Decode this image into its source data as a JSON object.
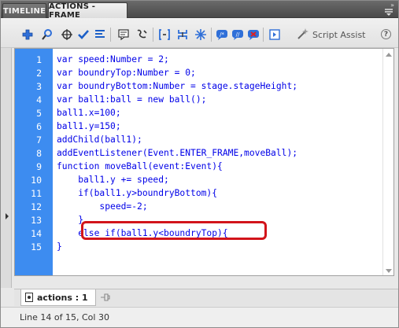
{
  "tabs": {
    "timeline": "TIMELINE",
    "actions": "ACTIONS - FRAME"
  },
  "toolbar": {
    "icons": [
      "add-statement-icon",
      "find-icon",
      "insert-target-path-icon",
      "check-syntax-icon",
      "auto-format-icon",
      "show-code-hint-icon",
      "debug-options-icon",
      "collapse-between-braces-icon",
      "collapse-selection-icon",
      "expand-all-icon",
      "apply-block-comment-icon",
      "apply-line-comment-icon",
      "remove-comment-icon",
      "show-hide-toolbox-icon",
      "script-assist-icon",
      "help-icon"
    ],
    "script_assist_label": "Script Assist",
    "help_label": "?"
  },
  "editor": {
    "lines": [
      {
        "n": "1",
        "code": "var speed:Number = 2;"
      },
      {
        "n": "2",
        "code": "var boundryTop:Number = 0;"
      },
      {
        "n": "3",
        "code": "var boundryBottom:Number = stage.stageHeight;"
      },
      {
        "n": "4",
        "code": "var ball1:ball = new ball();"
      },
      {
        "n": "5",
        "code": "ball1.x=100;"
      },
      {
        "n": "6",
        "code": "ball1.y=150;"
      },
      {
        "n": "7",
        "code": "addChild(ball1);"
      },
      {
        "n": "8",
        "code": "addEventListener(Event.ENTER_FRAME,moveBall);"
      },
      {
        "n": "9",
        "code": "function moveBall(event:Event){"
      },
      {
        "n": "10",
        "code": "    ball1.y += speed;"
      },
      {
        "n": "11",
        "code": "    if(ball1.y>boundryBottom){"
      },
      {
        "n": "12",
        "code": "        speed=-2;"
      },
      {
        "n": "13",
        "code": "    }"
      },
      {
        "n": "14",
        "code": "    else if(ball1.y<boundryTop){"
      },
      {
        "n": "15",
        "code": "}"
      }
    ],
    "gutter_color": "#3d8cf0",
    "highlight_color": "#d2141a",
    "highlighted_line": "14"
  },
  "bottom": {
    "tab_label": "actions : 1"
  },
  "status": {
    "text": "Line 14 of 15, Col 30"
  }
}
